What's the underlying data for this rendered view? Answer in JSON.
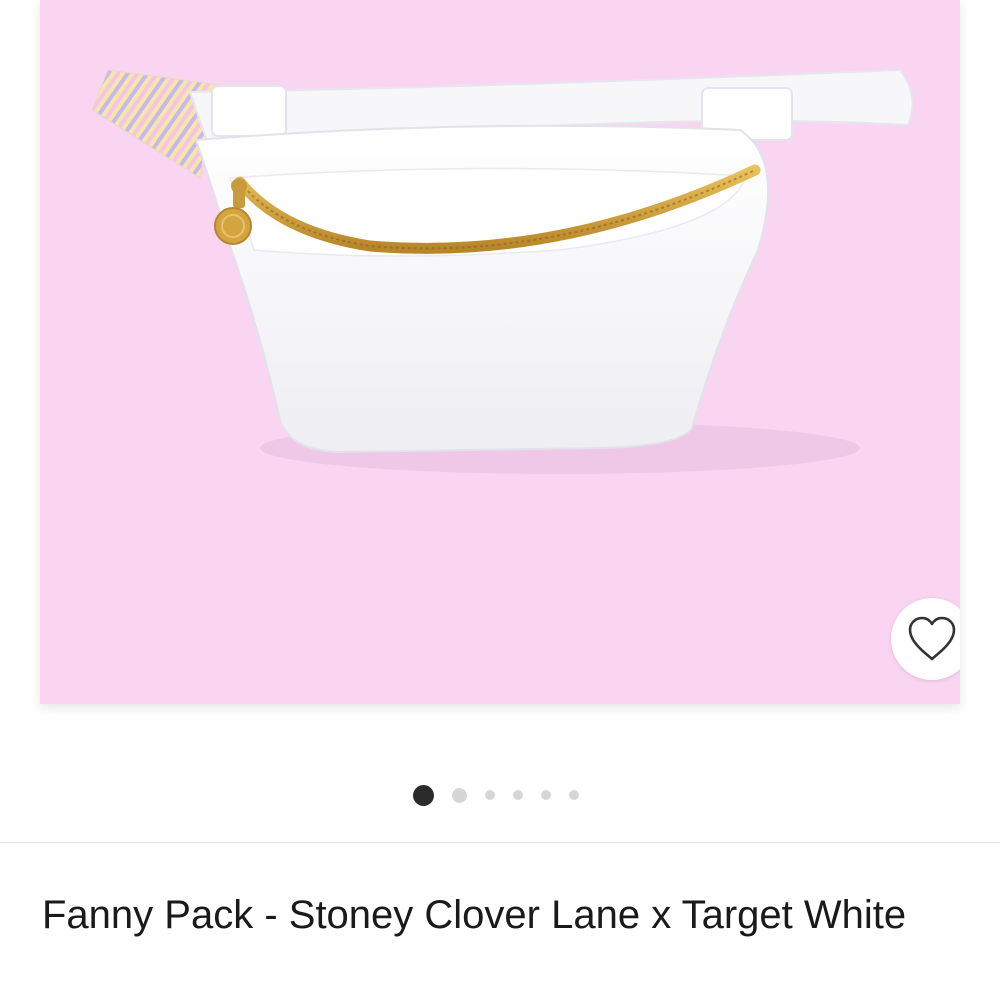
{
  "product": {
    "title": "Fanny Pack - Stoney Clover Lane x Target White",
    "image_background": "#f9d5f2",
    "image_alt": "White fanny pack with gold zipper and striped strap"
  },
  "favorite": {
    "icon": "heart-outline-icon",
    "aria_label": "Add to favorites"
  },
  "carousel": {
    "total_images": 6,
    "active_index": 0
  }
}
